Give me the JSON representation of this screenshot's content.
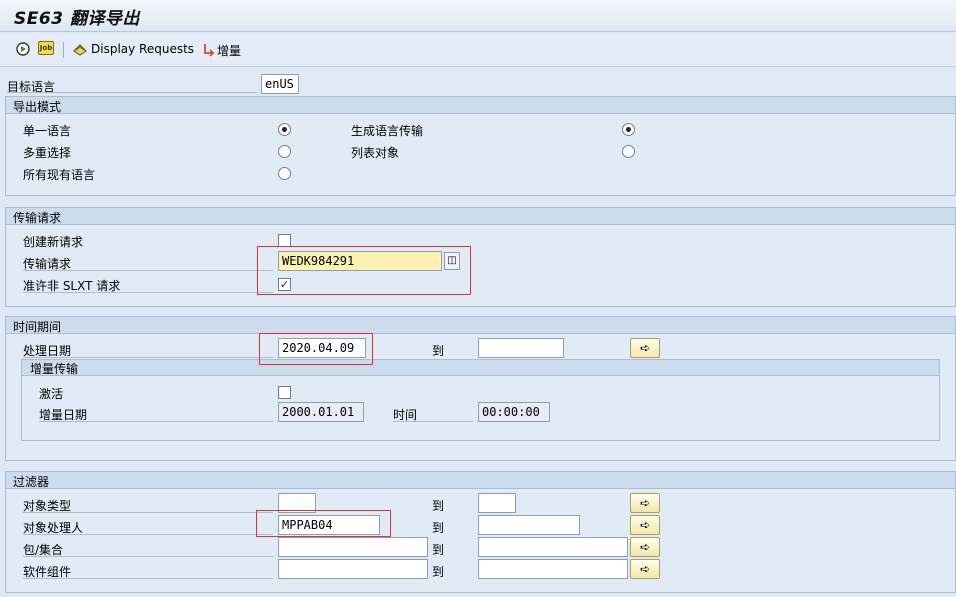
{
  "title": "SE63 翻译导出",
  "toolbar": {
    "display_requests": "Display Requests",
    "increment": "增量",
    "job_icon_text": "Job"
  },
  "target_language": {
    "label": "目标语言",
    "value": "enUS"
  },
  "export_mode": {
    "title": "导出模式",
    "options": [
      {
        "label": "单一语言",
        "selected": true
      },
      {
        "label": "多重选择",
        "selected": false
      },
      {
        "label": "所有现有语言",
        "selected": false
      }
    ],
    "right_options": [
      {
        "label": "生成语言传输",
        "selected": true
      },
      {
        "label": "列表对象",
        "selected": false
      }
    ]
  },
  "transport_request": {
    "title": "传输请求",
    "create_new_label": "创建新请求",
    "request_label": "传输请求",
    "request_value": "WEDK984291",
    "allow_non_slxt_label": "准许非 SLXT 请求",
    "create_new_checked": false,
    "allow_non_slxt_checked": true
  },
  "time_period": {
    "title": "时间期间",
    "process_date_label": "处理日期",
    "process_date_value": "2020.04.09",
    "to_label": "到",
    "to_value": "",
    "incremental": {
      "title": "增量传输",
      "activate_label": "激活",
      "activate_checked": false,
      "date_label": "增量日期",
      "date_value": "2000.01.01",
      "time_label": "时间",
      "time_value": "00:00:00"
    }
  },
  "filters": {
    "title": "过滤器",
    "rows": [
      {
        "label": "对象类型",
        "from": "",
        "to": ""
      },
      {
        "label": "对象处理人",
        "from": "MPPAB04",
        "to": ""
      },
      {
        "label": "包/集合",
        "from": "",
        "to": ""
      },
      {
        "label": "软件组件",
        "from": "",
        "to": ""
      }
    ],
    "to_label": "到"
  }
}
